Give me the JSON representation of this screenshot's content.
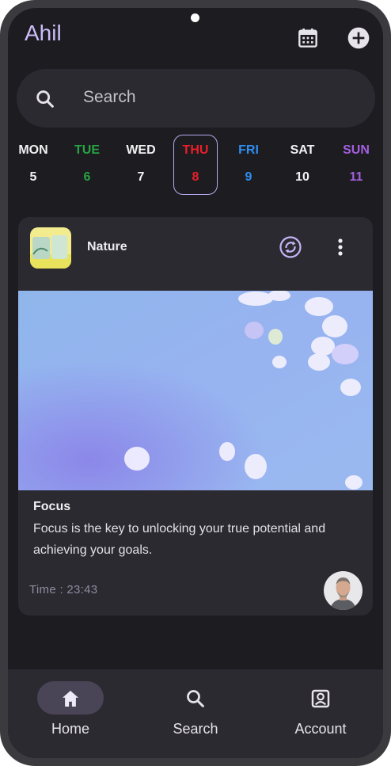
{
  "app": {
    "title": "Ahil"
  },
  "search": {
    "placeholder": "Search"
  },
  "calendar": {
    "days": [
      {
        "name": "MON",
        "num": "5",
        "color": "#f2f2f5"
      },
      {
        "name": "TUE",
        "num": "6",
        "color": "#27a344"
      },
      {
        "name": "WED",
        "num": "7",
        "color": "#f2f2f5"
      },
      {
        "name": "THU",
        "num": "8",
        "color": "#e8202a",
        "selected": true
      },
      {
        "name": "FRI",
        "num": "9",
        "color": "#2f8ef2"
      },
      {
        "name": "SAT",
        "num": "10",
        "color": "#f2f2f5"
      },
      {
        "name": "SUN",
        "num": "11",
        "color": "#a35fe0"
      }
    ]
  },
  "card": {
    "category": "Nature",
    "title": "Focus",
    "description": "Focus is the key to unlocking your true potential and achieving your goals.",
    "time": "Time : 23:43"
  },
  "nav": {
    "items": [
      {
        "label": "Home",
        "icon": "home-icon",
        "active": true
      },
      {
        "label": "Search",
        "icon": "search-icon",
        "active": false
      },
      {
        "label": "Account",
        "icon": "account-icon",
        "active": false
      }
    ]
  },
  "colors": {
    "accent": "#cdbdfa",
    "background": "#1d1c20",
    "surface": "#2b2a30"
  }
}
